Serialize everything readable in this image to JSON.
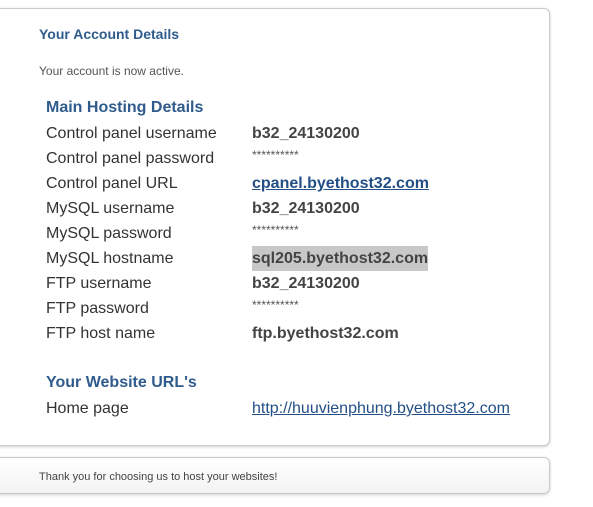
{
  "account": {
    "title": "Your Account Details",
    "status": "Your account is now active."
  },
  "hosting": {
    "heading": "Main Hosting Details",
    "rows": [
      {
        "label": "Control panel username",
        "value": "b32_24130200"
      },
      {
        "label": "Control panel password",
        "value": "**********"
      },
      {
        "label": "Control panel URL",
        "value": "cpanel.byethost32.com"
      },
      {
        "label": "MySQL username",
        "value": "b32_24130200"
      },
      {
        "label": "MySQL password",
        "value": "**********"
      },
      {
        "label": "MySQL hostname",
        "value": "sql205.byethost32.com"
      },
      {
        "label": "FTP username",
        "value": "b32_24130200"
      },
      {
        "label": "FTP password",
        "value": "**********"
      },
      {
        "label": "FTP host name",
        "value": "ftp.byethost32.com"
      }
    ]
  },
  "website": {
    "heading": "Your Website URL's",
    "rows": [
      {
        "label": "Home page",
        "value": "http://huuvienphung.byethost32.com"
      }
    ]
  },
  "footer": {
    "text": "Thank you for choosing us to host your websites!"
  },
  "colors": {
    "heading": "#2f5b8d",
    "link": "#234f86",
    "highlight": "#c8c8c8"
  }
}
